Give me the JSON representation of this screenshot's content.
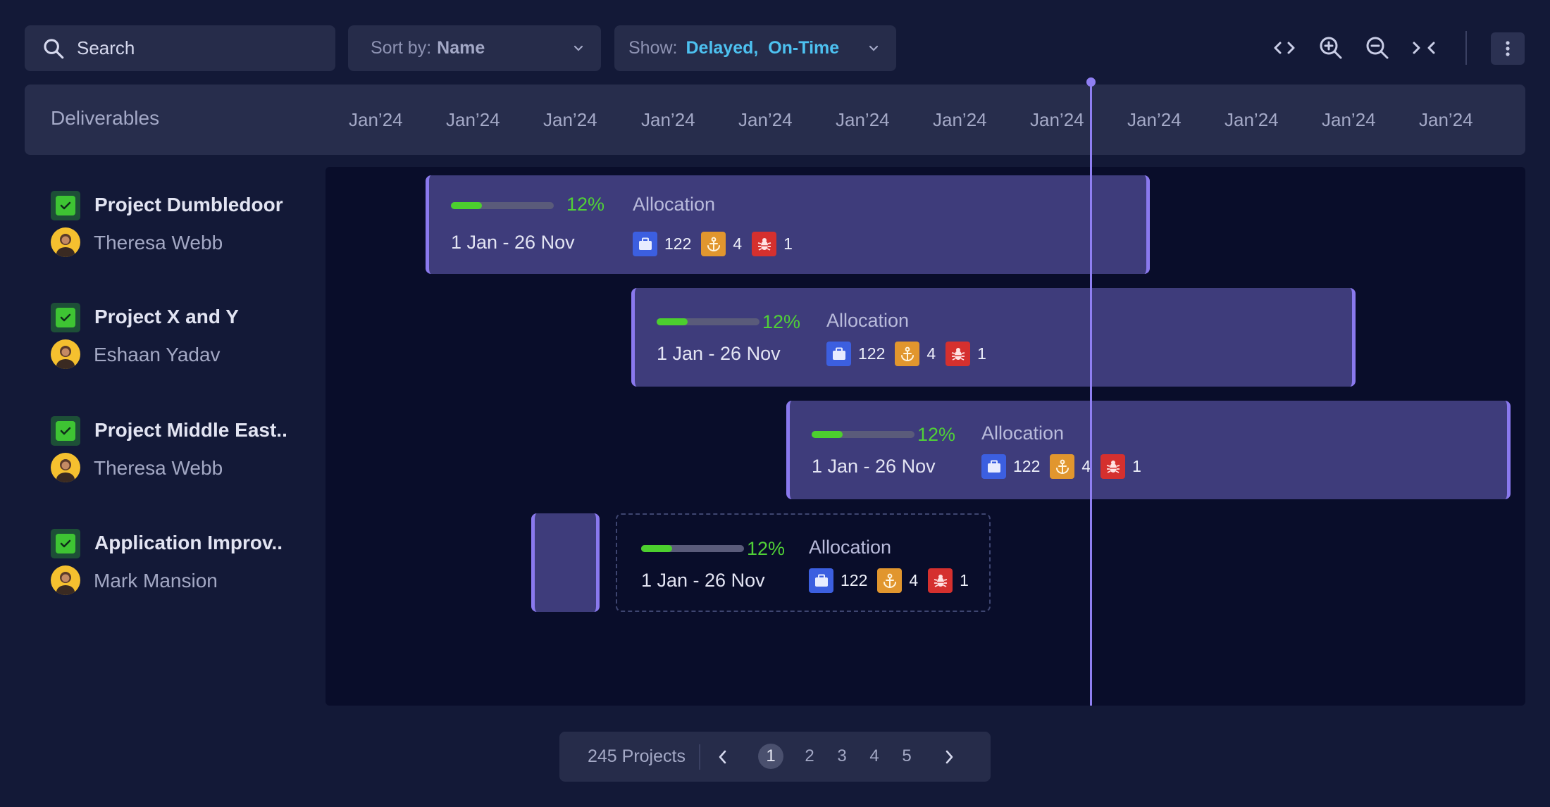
{
  "toolbar": {
    "search_placeholder": "Search",
    "sort_label": "Sort by:",
    "sort_value": "Name",
    "show_label": "Show:",
    "show_value": "Delayed,  On-Time"
  },
  "header": {
    "title": "Deliverables",
    "months": [
      "Jan’24",
      "Jan’24",
      "Jan’24",
      "Jan’24",
      "Jan’24",
      "Jan’24",
      "Jan’24",
      "Jan’24",
      "Jan’24",
      "Jan’24",
      "Jan’24",
      "Jan’24"
    ]
  },
  "deliverables": [
    {
      "name": "Project Dumbledoor",
      "owner": "Theresa Webb"
    },
    {
      "name": "Project X and Y",
      "owner": "Eshaan Yadav"
    },
    {
      "name": "Project Middle East..",
      "owner": "Theresa Webb"
    },
    {
      "name": "Application Improv..",
      "owner": "Mark Mansion"
    }
  ],
  "bars": [
    {
      "percent": "12%",
      "progress": 0.3,
      "label": "Allocation",
      "dates": "1 Jan - 26 Nov",
      "briefcase": "122",
      "anchor": "4",
      "bug": "1"
    },
    {
      "percent": "12%",
      "progress": 0.3,
      "label": "Allocation",
      "dates": "1 Jan - 26 Nov",
      "briefcase": "122",
      "anchor": "4",
      "bug": "1"
    },
    {
      "percent": "12%",
      "progress": 0.3,
      "label": "Allocation",
      "dates": "1 Jan - 26 Nov",
      "briefcase": "122",
      "anchor": "4",
      "bug": "1"
    },
    {
      "percent": "12%",
      "progress": 0.3,
      "label": "Allocation",
      "dates": "1 Jan - 26 Nov",
      "briefcase": "122",
      "anchor": "4",
      "bug": "1"
    }
  ],
  "pagination": {
    "count": "245 Projects",
    "pages": [
      "1",
      "2",
      "3",
      "4",
      "5"
    ],
    "current": "1"
  },
  "colors": {
    "background": "#131937",
    "panel": "#262c4a",
    "bar": "#3e3c7b",
    "accent": "#8a79ee",
    "progress": "#4ccf2e",
    "show_value": "#4dc1f0"
  },
  "icons": [
    "search-icon",
    "chevron-down-icon",
    "expand-icon",
    "zoom-in-icon",
    "zoom-out-icon",
    "collapse-icon",
    "more-vertical-icon",
    "checkbox-icon",
    "avatar",
    "briefcase-icon",
    "anchor-icon",
    "bug-icon",
    "chevron-left-icon",
    "chevron-right-icon"
  ]
}
